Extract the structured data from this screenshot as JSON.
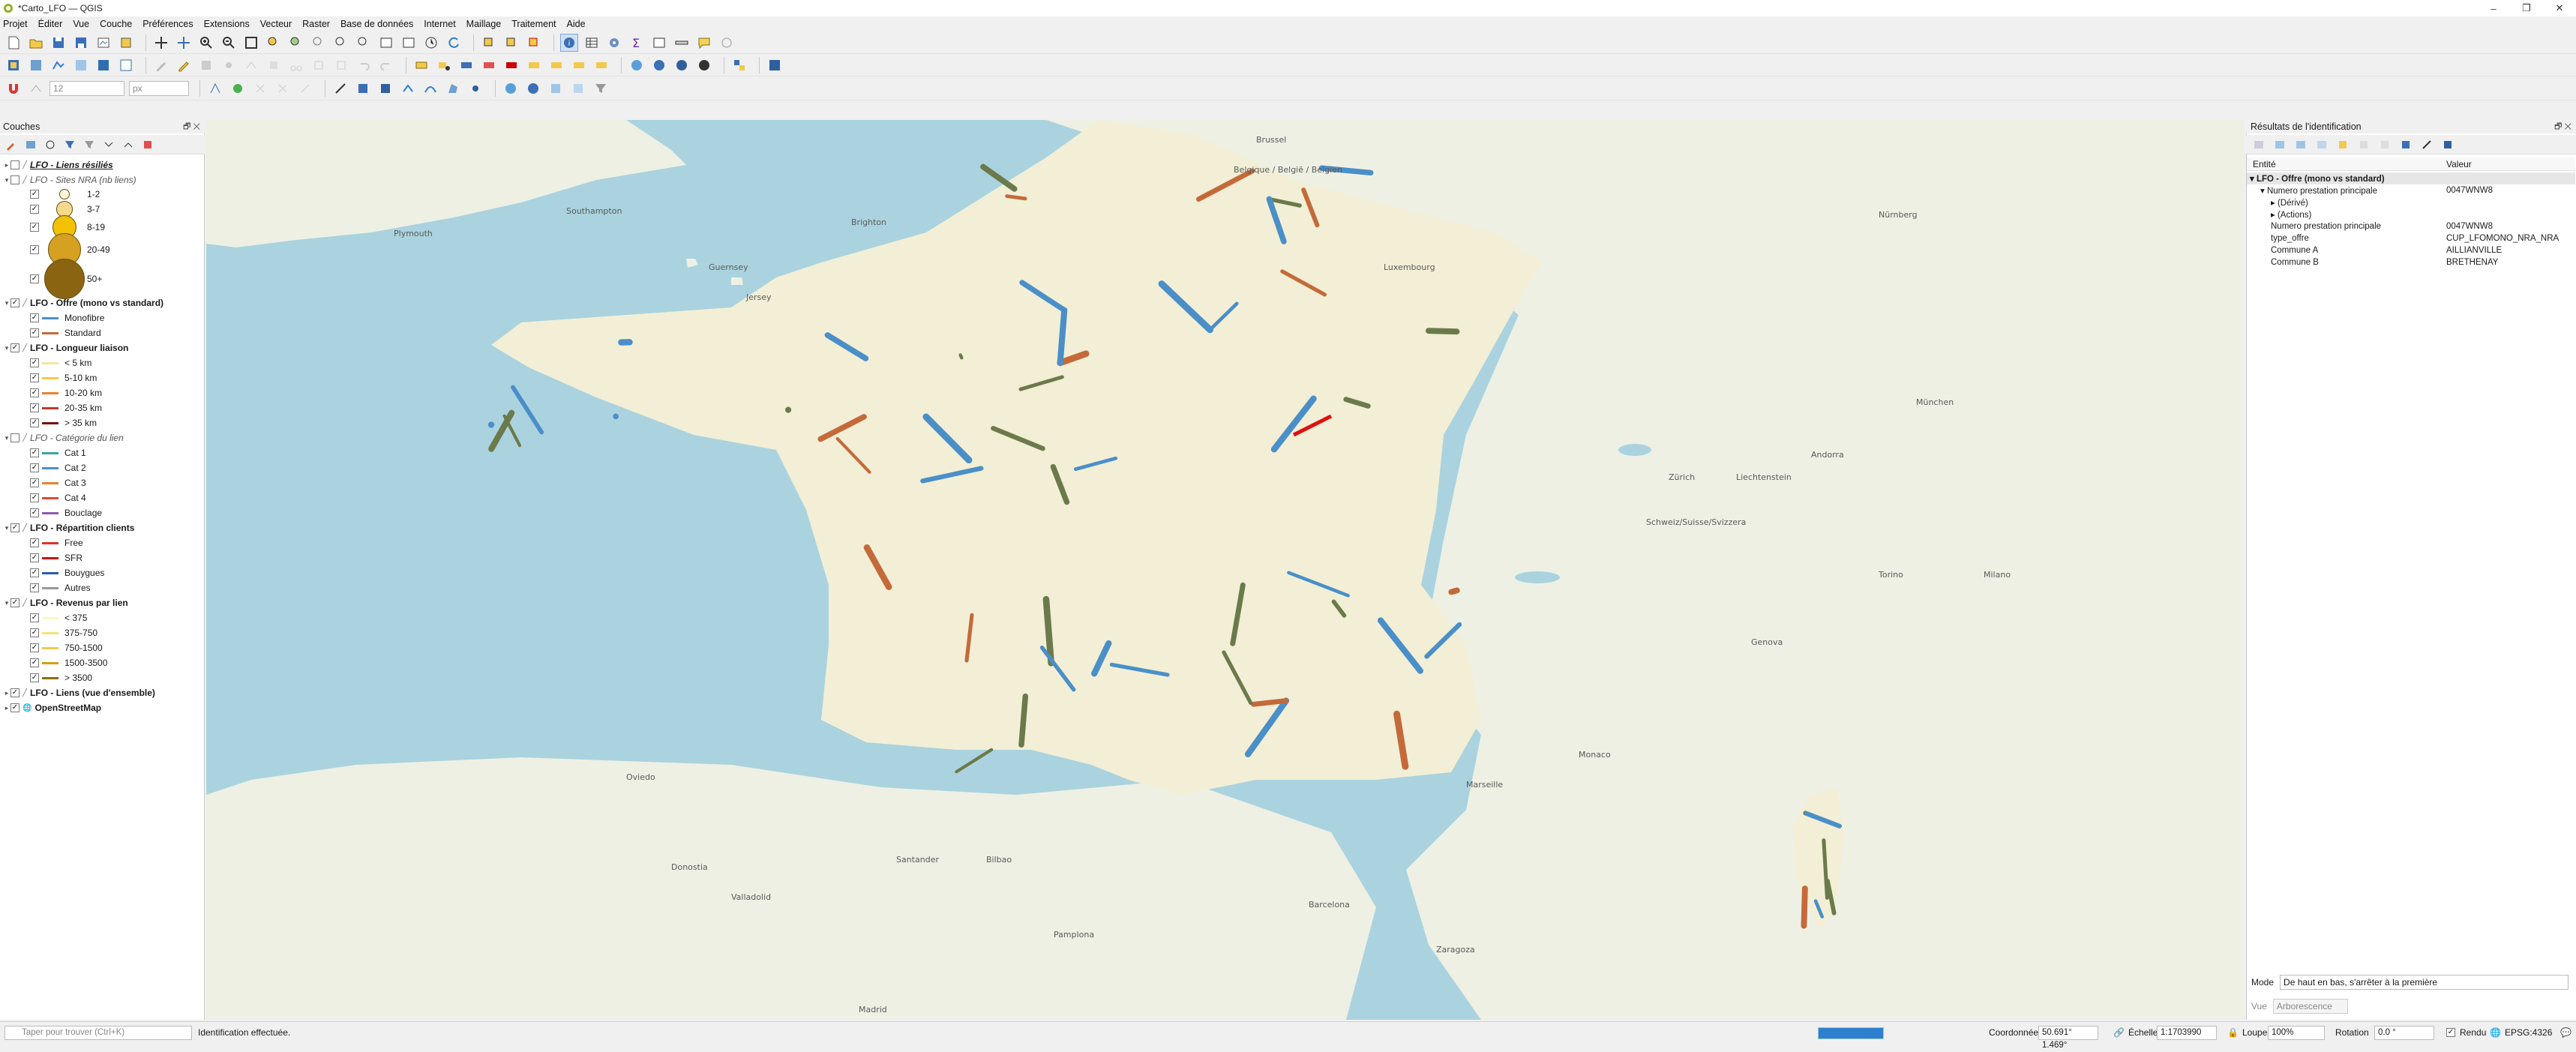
{
  "window": {
    "title": "*Carto_LFO — QGIS"
  },
  "menu": [
    "Projet",
    "Éditer",
    "Vue",
    "Couche",
    "Préférences",
    "Extensions",
    "Vecteur",
    "Raster",
    "Base de données",
    "Internet",
    "Maillage",
    "Traitement",
    "Aide"
  ],
  "toolbar3": {
    "size_value": "12",
    "unit_value": "px"
  },
  "layers_panel": {
    "title": "Couches",
    "items": [
      {
        "kind": "layer",
        "label": "LFO - Liens résiliés",
        "style": "red",
        "checked": false,
        "expanded": false
      },
      {
        "kind": "layer",
        "label": "LFO - Sites NRA (nb liens)",
        "style": "italic",
        "checked": false,
        "expanded": true
      },
      {
        "kind": "circle",
        "label": "1-2"
      },
      {
        "kind": "circle",
        "label": "3-7"
      },
      {
        "kind": "circle",
        "label": "8-19"
      },
      {
        "kind": "circle",
        "label": "20-49"
      },
      {
        "kind": "circle",
        "label": "50+"
      },
      {
        "kind": "layer",
        "label": "LFO - Offre (mono vs standard)",
        "style": "bold",
        "checked": true,
        "expanded": true
      },
      {
        "kind": "line",
        "label": "Monofibre",
        "color": "#4a8fc8"
      },
      {
        "kind": "line",
        "label": "Standard",
        "color": "#c46a3a"
      },
      {
        "kind": "layer",
        "label": "LFO - Longueur liaison",
        "style": "bold",
        "checked": true,
        "expanded": true
      },
      {
        "kind": "line",
        "label": "< 5 km",
        "color": "#f3e6a0"
      },
      {
        "kind": "line",
        "label": "5-10 km",
        "color": "#f2c94c"
      },
      {
        "kind": "line",
        "label": "10-20 km",
        "color": "#e8822e"
      },
      {
        "kind": "line",
        "label": "20-35 km",
        "color": "#c0392b"
      },
      {
        "kind": "line",
        "label": "> 35 km",
        "color": "#7a0c0c"
      },
      {
        "kind": "layer",
        "label": "LFO - Catégorie du lien",
        "style": "italic",
        "checked": false,
        "expanded": true
      },
      {
        "kind": "line",
        "label": "Cat 1",
        "color": "#3aa6a6"
      },
      {
        "kind": "line",
        "label": "Cat 2",
        "color": "#4a8fc8"
      },
      {
        "kind": "line",
        "label": "Cat 3",
        "color": "#e8822e"
      },
      {
        "kind": "line",
        "label": "Cat 4",
        "color": "#d94b3a"
      },
      {
        "kind": "line",
        "label": "Bouclage",
        "color": "#8e5bb0"
      },
      {
        "kind": "layer",
        "label": "LFO - Répartition clients",
        "style": "bold",
        "checked": true,
        "expanded": true
      },
      {
        "kind": "line",
        "label": "Free",
        "color": "#e03030"
      },
      {
        "kind": "line",
        "label": "SFR",
        "color": "#d01010"
      },
      {
        "kind": "line",
        "label": "Bouygues",
        "color": "#2a5caa"
      },
      {
        "kind": "line",
        "label": "Autres",
        "color": "#9a9a9a"
      },
      {
        "kind": "layer",
        "label": "LFO - Revenus par lien",
        "style": "bold",
        "checked": true,
        "expanded": true
      },
      {
        "kind": "line",
        "label": "< 375",
        "color": "#fff6c8"
      },
      {
        "kind": "line",
        "label": "375-750",
        "color": "#f7e27a"
      },
      {
        "kind": "line",
        "label": "750-1500",
        "color": "#f2c94c"
      },
      {
        "kind": "line",
        "label": "1500-3500",
        "color": "#d4a017"
      },
      {
        "kind": "line",
        "label": "> 3500",
        "color": "#8a6d0b"
      },
      {
        "kind": "layer",
        "label": "LFO - Liens (vue d'ensemble)",
        "style": "bold",
        "checked": true,
        "expanded": false
      },
      {
        "kind": "layer",
        "label": "OpenStreetMap",
        "style": "bold",
        "checked": true,
        "expanded": false
      }
    ]
  },
  "map": {
    "labels": [
      {
        "text": "Plymouth"
      },
      {
        "text": "Southampton"
      },
      {
        "text": "Brighton"
      },
      {
        "text": "Guernsey"
      },
      {
        "text": "Jersey"
      },
      {
        "text": "Brussel"
      },
      {
        "text": "Belgique / België / Belgien"
      },
      {
        "text": "Luxembourg"
      },
      {
        "text": "Nürnberg"
      },
      {
        "text": "München"
      },
      {
        "text": "Zürich"
      },
      {
        "text": "Liechtenstein"
      },
      {
        "text": "Schweiz/Suisse/Svizzera"
      },
      {
        "text": "Torino"
      },
      {
        "text": "Genova"
      },
      {
        "text": "Milano"
      },
      {
        "text": "Andorra"
      },
      {
        "text": "Barcelona"
      },
      {
        "text": "Zaragoza"
      },
      {
        "text": "Pamplona"
      },
      {
        "text": "Bilbao"
      },
      {
        "text": "Donostia"
      },
      {
        "text": "Santander"
      },
      {
        "text": "Oviedo"
      },
      {
        "text": "Madrid"
      },
      {
        "text": "Valladolid"
      },
      {
        "text": "Marseille"
      },
      {
        "text": "Monaco"
      }
    ]
  },
  "identify_panel": {
    "title": "Résultats de l'identification",
    "col_entity": "Entité",
    "col_value": "Valeur",
    "rows": [
      {
        "level": 0,
        "arrow": "▾",
        "key": "LFO - Offre (mono vs standard)",
        "value": "",
        "bold": true
      },
      {
        "level": 1,
        "arrow": "▾",
        "key": "Numero prestation principale",
        "value": "0047WNW8",
        "bold": false
      },
      {
        "level": 2,
        "arrow": "▸",
        "key": "(Dérivé)",
        "value": "",
        "bold": false
      },
      {
        "level": 2,
        "arrow": "▸",
        "key": "(Actions)",
        "value": "",
        "bold": false
      },
      {
        "level": 2,
        "arrow": "",
        "key": "Numero prestation principale",
        "value": "0047WNW8",
        "bold": false
      },
      {
        "level": 2,
        "arrow": "",
        "key": "type_offre",
        "value": "CUP_LFOMONO_NRA_NRA",
        "bold": false
      },
      {
        "level": 2,
        "arrow": "",
        "key": "Commune A",
        "value": "AILLIANVILLE",
        "bold": false
      },
      {
        "level": 2,
        "arrow": "",
        "key": "Commune B",
        "value": "BRETHENAY",
        "bold": false
      }
    ],
    "mode_label": "Mode",
    "mode_value": "De haut en bas, s'arrêter à la première",
    "view_label": "Vue",
    "view_value": "Arborescence"
  },
  "statusbar": {
    "locator_placeholder": "Taper pour trouver (Ctrl+K)",
    "message": "Identification effectuée.",
    "coord_label": "Coordonnée",
    "coord_value": "50.691° 1.469°",
    "scale_label": "Échelle",
    "scale_value": "1:1703990",
    "magnifier_label": "Loupe",
    "magnifier_value": "100%",
    "rotation_label": "Rotation",
    "rotation_value": "0.0 °",
    "render_label": "Rendu",
    "crs_label": "EPSG:4326"
  },
  "colors": {
    "sea": "#aad3df",
    "land_fr": "#f2efd6",
    "land_other": "#eef0e4",
    "mono": "#4a8fc8",
    "standard": "#c46a3a",
    "dark_link": "#6b7a4a",
    "highlight": "#e01010"
  }
}
